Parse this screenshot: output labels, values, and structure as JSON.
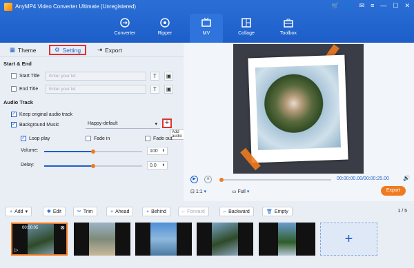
{
  "app": {
    "title": "AnyMP4 Video Converter Ultimate (Unregistered)"
  },
  "nav": [
    {
      "label": "Converter",
      "icon": "converter-icon"
    },
    {
      "label": "Ripper",
      "icon": "ripper-icon"
    },
    {
      "label": "MV",
      "icon": "mv-icon",
      "active": true
    },
    {
      "label": "Collage",
      "icon": "collage-icon"
    },
    {
      "label": "Toolbox",
      "icon": "toolbox-icon"
    }
  ],
  "tabs": {
    "theme": "Theme",
    "setting": "Setting",
    "export": "Export"
  },
  "start_end": {
    "title": "Start & End",
    "start_label": "Start Title",
    "end_label": "End Title",
    "placeholder": "Enter your txt",
    "t_btn": "T"
  },
  "audio": {
    "title": "Audio Track",
    "keep_label": "Keep original audio track",
    "bgm_label": "Background Music",
    "bgm_value": "Happy-default",
    "add_tooltip": "Add audio",
    "loop_label": "Loop play",
    "fade_in_label": "Fade in",
    "fade_out_label": "Fade out",
    "volume_label": "Volume:",
    "volume_value": "100",
    "delay_label": "Delay:",
    "delay_value": "0.0"
  },
  "player": {
    "time": "00:00:00.00/00:00:25.00",
    "ratio": "1:1",
    "full": "Full",
    "export": "Export"
  },
  "toolbar": {
    "add": "Add",
    "edit": "Edit",
    "trim": "Trim",
    "ahead": "Ahead",
    "behind": "Behind",
    "forward": "Forward",
    "backward": "Backward",
    "empty": "Empty",
    "pager": "1 / 5"
  },
  "timeline": {
    "first_duration": "00:00:05"
  }
}
